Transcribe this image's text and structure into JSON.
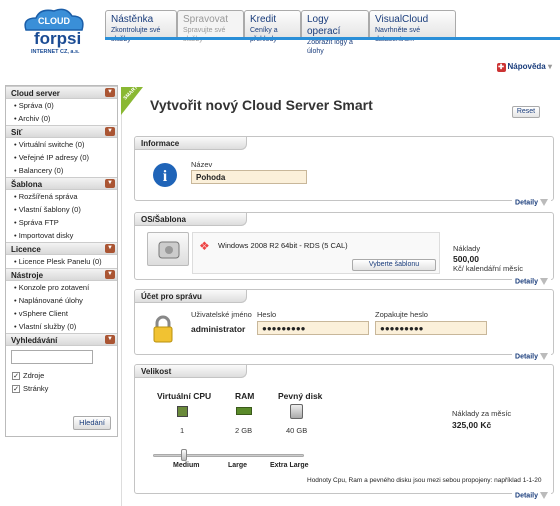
{
  "logo": {
    "word1": "CLOUD",
    "word2": "forpsi",
    "sub": "INTERNET CZ, a.s."
  },
  "tabs": [
    {
      "title": "Nástěnka",
      "sub": "Zkontrolujte své služby"
    },
    {
      "title": "Spravovat",
      "sub": "Spravujte své služby"
    },
    {
      "title": "Kredit",
      "sub": "Ceníky a přehledy"
    },
    {
      "title": "Logy operací",
      "sub": "Zobrazit logy a úlohy"
    },
    {
      "title": "VisualCloud",
      "sub": "Navrhněte své datacentrum"
    }
  ],
  "help_label": "Nápověda",
  "sidebar": {
    "sections": [
      {
        "title": "Cloud server",
        "items": [
          "Správa (0)",
          "Archiv (0)"
        ]
      },
      {
        "title": "Síť",
        "items": [
          "Virtuální switche (0)",
          "Veřejné IP adresy (0)",
          "Balancery (0)"
        ]
      },
      {
        "title": "Šablona",
        "items": [
          "Rozšířená správa",
          "Vlastní šablony (0)",
          "Správa FTP",
          "Importovat disky"
        ]
      },
      {
        "title": "Licence",
        "items": [
          "Licence Plesk Panelu (0)"
        ]
      },
      {
        "title": "Nástroje",
        "items": [
          "Konzole pro zotavení",
          "Naplánované úlohy",
          "vSphere Client",
          "Vlastní služby (0)"
        ]
      }
    ],
    "search": {
      "title": "Vyhledávání",
      "checks": [
        "Zdroje",
        "Stránky"
      ],
      "button": "Hledání"
    }
  },
  "ribbon": "SMART",
  "page_title": "Vytvořit nový Cloud Server Smart",
  "reset": "Reset",
  "details": "Detaily",
  "info": {
    "title": "Informace",
    "name_label": "Název",
    "name_value": "Pohoda"
  },
  "os": {
    "title": "OS/Šablona",
    "template": "Windows 2008 R2 64bit - RDS (5 CAL)",
    "choose": "Vyberte šablonu",
    "cost_label": "Náklady",
    "cost_value": "500,00",
    "cost_unit": "Kč/ kalendářní měsíc"
  },
  "account": {
    "title": "Účet pro správu",
    "user_label": "Uživatelské jméno",
    "user_value": "administrator",
    "pass_label": "Heslo",
    "pass_value": "●●●●●●●●●",
    "repeat_label": "Zopakujte heslo",
    "repeat_value": "●●●●●●●●●"
  },
  "size": {
    "title": "Velikost",
    "cpu_label": "Virtuální CPU",
    "cpu_value": "1",
    "ram_label": "RAM",
    "ram_value": "2 GB",
    "disk_label": "Pevný disk",
    "disk_value": "40 GB",
    "cost_label": "Náklady za měsíc",
    "cost_value": "325,00 Kč",
    "slider_labels": [
      "Medium",
      "Large",
      "Extra Large"
    ],
    "note": "Hodnoty Cpu, Ram a pevného disku jsou mezi sebou propojeny: například 1-1-20"
  },
  "colors": {
    "tab_line": "#2a8fd8",
    "ribbon": "#8ab833",
    "field_bg": "#fbf0da"
  }
}
